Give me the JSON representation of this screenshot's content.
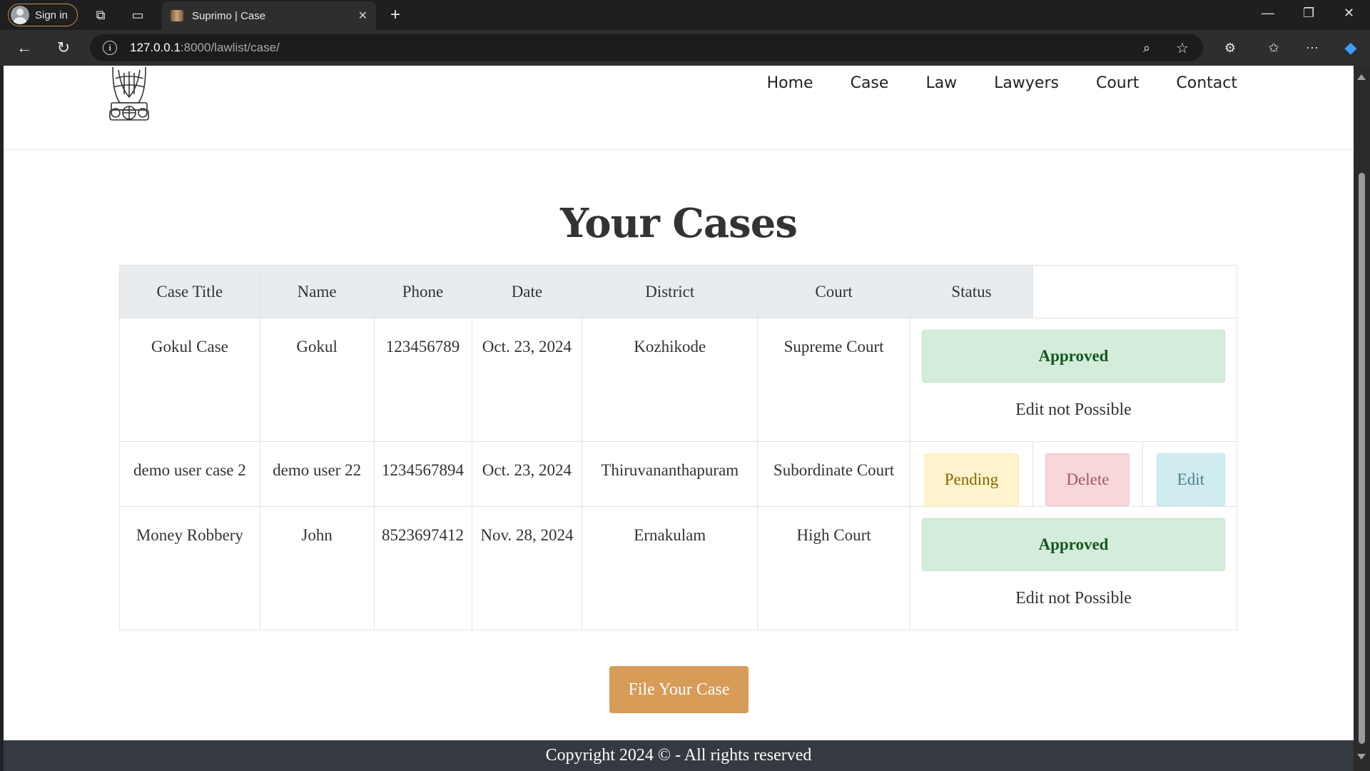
{
  "browser": {
    "signin_label": "Sign in",
    "tab_title": "Suprimo | Case",
    "url_host": "127.0.0.1",
    "url_path": ":8000/lawlist/case/"
  },
  "nav": {
    "items": [
      {
        "label": "Home"
      },
      {
        "label": "Case"
      },
      {
        "label": "Law"
      },
      {
        "label": "Lawyers"
      },
      {
        "label": "Court"
      },
      {
        "label": "Contact"
      }
    ]
  },
  "page": {
    "title": "Your Cases",
    "file_button": "File Your Case",
    "footer": "Copyright 2024 © - All rights reserved"
  },
  "table": {
    "headers": [
      "Case Title",
      "Name",
      "Phone",
      "Date",
      "District",
      "Court",
      "Status"
    ],
    "rows": [
      {
        "title": "Gokul Case",
        "name": "Gokul",
        "phone": "123456789",
        "date": "Oct. 23, 2024",
        "district": "Kozhikode",
        "court": "Supreme Court",
        "status": "Approved",
        "note": "Edit not Possible"
      },
      {
        "title": "demo user case 2",
        "name": "demo user 22",
        "phone": "1234567894",
        "date": "Oct. 23, 2024",
        "district": "Thiruvananthapuram",
        "court": "Subordinate Court",
        "status": "Pending",
        "delete_label": "Delete",
        "edit_label": "Edit"
      },
      {
        "title": "Money Robbery",
        "name": "John",
        "phone": "8523697412",
        "date": "Nov. 28, 2024",
        "district": "Ernakulam",
        "court": "High Court",
        "status": "Approved",
        "note": "Edit not Possible"
      }
    ]
  },
  "colors": {
    "accent_button": "#d69c58",
    "footer_bg": "#343a40",
    "approved_bg": "#d4edda",
    "pending_bg": "#fff3cd",
    "delete_bg": "#f8d7da",
    "edit_bg": "#d1ecf1"
  }
}
